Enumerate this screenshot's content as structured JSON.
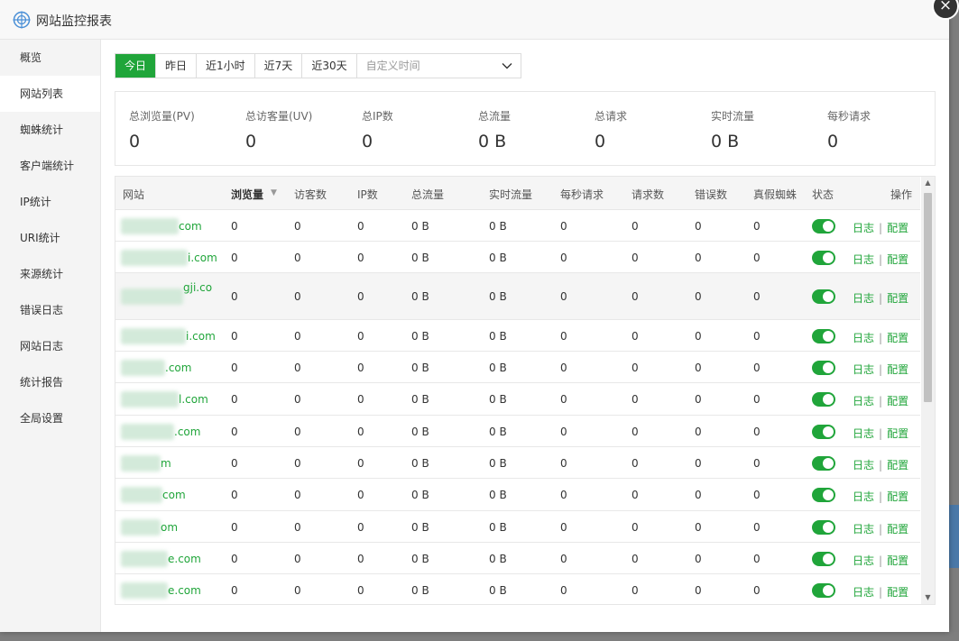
{
  "window": {
    "title": "网站监控报表",
    "close_label": "×"
  },
  "sidebar": {
    "items": [
      {
        "label": "概览"
      },
      {
        "label": "网站列表"
      },
      {
        "label": "蜘蛛统计"
      },
      {
        "label": "客户端统计"
      },
      {
        "label": "IP统计"
      },
      {
        "label": "URI统计"
      },
      {
        "label": "来源统计"
      },
      {
        "label": "错误日志"
      },
      {
        "label": "网站日志"
      },
      {
        "label": "统计报告"
      },
      {
        "label": "全局设置"
      }
    ],
    "active_index": 1
  },
  "time_filter": {
    "options": [
      {
        "label": "今日"
      },
      {
        "label": "昨日"
      },
      {
        "label": "近1小时"
      },
      {
        "label": "近7天"
      },
      {
        "label": "近30天"
      }
    ],
    "active_index": 0,
    "custom_placeholder": "自定义时间"
  },
  "summary": [
    {
      "label": "总浏览量(PV)",
      "value": "0"
    },
    {
      "label": "总访客量(UV)",
      "value": "0"
    },
    {
      "label": "总IP数",
      "value": "0"
    },
    {
      "label": "总流量",
      "value": "0 B"
    },
    {
      "label": "总请求",
      "value": "0"
    },
    {
      "label": "实时流量",
      "value": "0 B"
    },
    {
      "label": "每秒请求",
      "value": "0"
    }
  ],
  "table": {
    "headers": [
      "网站",
      "浏览量",
      "访客数",
      "IP数",
      "总流量",
      "实时流量",
      "每秒请求",
      "请求数",
      "错误数",
      "真假蜘蛛",
      "状态",
      "操作"
    ],
    "sorted_column": "浏览量",
    "rows": [
      {
        "site": "com",
        "pv": "0",
        "uv": "0",
        "ip": "0",
        "traffic": "0 B",
        "realtime": "0 B",
        "qps": "0",
        "requests": "0",
        "errors": "0",
        "spiders": "0",
        "status": "on",
        "log_label": "日志",
        "config_label": "配置"
      },
      {
        "site": "i.com",
        "pv": "0",
        "uv": "0",
        "ip": "0",
        "traffic": "0 B",
        "realtime": "0 B",
        "qps": "0",
        "requests": "0",
        "errors": "0",
        "spiders": "0",
        "status": "on",
        "log_label": "日志",
        "config_label": "配置"
      },
      {
        "site": "gji.co",
        "pv": "0",
        "uv": "0",
        "ip": "0",
        "traffic": "0 B",
        "realtime": "0 B",
        "qps": "0",
        "requests": "0",
        "errors": "0",
        "spiders": "0",
        "status": "on",
        "log_label": "日志",
        "config_label": "配置"
      },
      {
        "site": "i.com",
        "pv": "0",
        "uv": "0",
        "ip": "0",
        "traffic": "0 B",
        "realtime": "0 B",
        "qps": "0",
        "requests": "0",
        "errors": "0",
        "spiders": "0",
        "status": "on",
        "log_label": "日志",
        "config_label": "配置"
      },
      {
        "site": ".com",
        "pv": "0",
        "uv": "0",
        "ip": "0",
        "traffic": "0 B",
        "realtime": "0 B",
        "qps": "0",
        "requests": "0",
        "errors": "0",
        "spiders": "0",
        "status": "on",
        "log_label": "日志",
        "config_label": "配置"
      },
      {
        "site": "l.com",
        "pv": "0",
        "uv": "0",
        "ip": "0",
        "traffic": "0 B",
        "realtime": "0 B",
        "qps": "0",
        "requests": "0",
        "errors": "0",
        "spiders": "0",
        "status": "on",
        "log_label": "日志",
        "config_label": "配置"
      },
      {
        "site": ".com",
        "pv": "0",
        "uv": "0",
        "ip": "0",
        "traffic": "0 B",
        "realtime": "0 B",
        "qps": "0",
        "requests": "0",
        "errors": "0",
        "spiders": "0",
        "status": "on",
        "log_label": "日志",
        "config_label": "配置"
      },
      {
        "site": "m",
        "pv": "0",
        "uv": "0",
        "ip": "0",
        "traffic": "0 B",
        "realtime": "0 B",
        "qps": "0",
        "requests": "0",
        "errors": "0",
        "spiders": "0",
        "status": "on",
        "log_label": "日志",
        "config_label": "配置"
      },
      {
        "site": "com",
        "pv": "0",
        "uv": "0",
        "ip": "0",
        "traffic": "0 B",
        "realtime": "0 B",
        "qps": "0",
        "requests": "0",
        "errors": "0",
        "spiders": "0",
        "status": "on",
        "log_label": "日志",
        "config_label": "配置"
      },
      {
        "site": "om",
        "pv": "0",
        "uv": "0",
        "ip": "0",
        "traffic": "0 B",
        "realtime": "0 B",
        "qps": "0",
        "requests": "0",
        "errors": "0",
        "spiders": "0",
        "status": "on",
        "log_label": "日志",
        "config_label": "配置"
      },
      {
        "site": "e.com",
        "pv": "0",
        "uv": "0",
        "ip": "0",
        "traffic": "0 B",
        "realtime": "0 B",
        "qps": "0",
        "requests": "0",
        "errors": "0",
        "spiders": "0",
        "status": "on",
        "log_label": "日志",
        "config_label": "配置"
      },
      {
        "site": "e.com",
        "pv": "0",
        "uv": "0",
        "ip": "0",
        "traffic": "0 B",
        "realtime": "0 B",
        "qps": "0",
        "requests": "0",
        "errors": "0",
        "spiders": "0",
        "status": "on",
        "log_label": "日志",
        "config_label": "配置"
      }
    ]
  },
  "colors": {
    "accent": "#20a53a"
  }
}
